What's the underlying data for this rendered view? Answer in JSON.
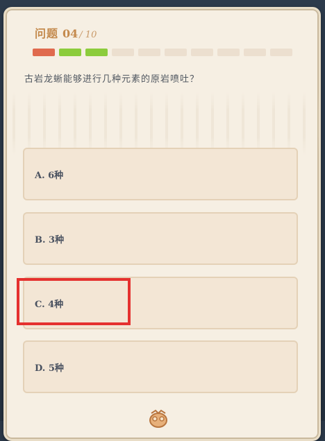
{
  "header": {
    "label": "问题",
    "number": "04",
    "total": "/ 10"
  },
  "progress": {
    "segments": [
      "wrong",
      "right",
      "right",
      "empty",
      "empty",
      "empty",
      "empty",
      "empty",
      "empty",
      "empty"
    ],
    "colors": {
      "wrong": "#e06a4e",
      "right": "#8ccc3c",
      "empty": "#ecdfcf"
    }
  },
  "question": "古岩龙蜥能够进行几种元素的原岩喷吐？",
  "options": [
    {
      "label": "A. 6种"
    },
    {
      "label": "B. 3种"
    },
    {
      "label": "C. 4种"
    },
    {
      "label": "D. 5种"
    }
  ],
  "highlight_color": "#e5312f",
  "emblem_icon": "paimon-emblem-icon"
}
